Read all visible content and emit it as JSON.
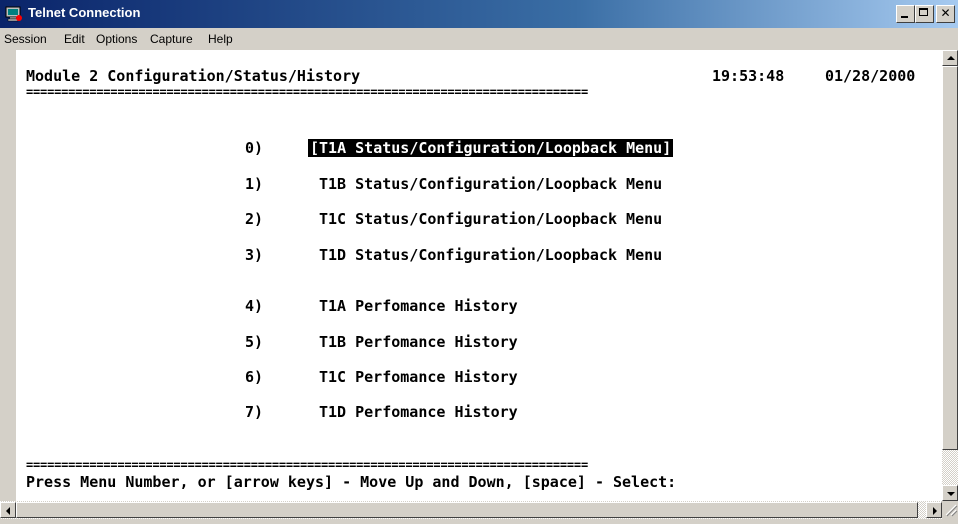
{
  "window": {
    "title": "Telnet Connection",
    "icon": "telnet-icon",
    "controls": [
      "minimize-icon",
      "maximize-icon",
      "close-icon"
    ]
  },
  "menubar": {
    "items": [
      "Session",
      "Edit",
      "Options",
      "Capture",
      "Help"
    ]
  },
  "terminal": {
    "header": "Module 2 Configuration/Status/History",
    "time": "19:53:48",
    "date": "01/28/2000",
    "separator": "================================================================================",
    "selected_index": 0,
    "menu": [
      {
        "num": "0)",
        "label": "[T1A Status/Configuration/Loopback Menu]"
      },
      {
        "num": "1)",
        "label": "T1B Status/Configuration/Loopback Menu"
      },
      {
        "num": "2)",
        "label": "T1C Status/Configuration/Loopback Menu"
      },
      {
        "num": "3)",
        "label": "T1D Status/Configuration/Loopback Menu"
      },
      {
        "num": "4)",
        "label": "T1A Perfomance History"
      },
      {
        "num": "5)",
        "label": "T1B Perfomance History"
      },
      {
        "num": "6)",
        "label": "T1C Perfomance History"
      },
      {
        "num": "7)",
        "label": "T1D Perfomance History"
      }
    ],
    "prompt": "Press Menu Number, or [arrow keys] - Move Up and Down, [space] - Select:"
  },
  "colors": {
    "title_bar_start": "#0a246a",
    "title_bar_end": "#a6caf0",
    "terminal_bg": "#ffffff",
    "terminal_text": "#000000",
    "selection_bg": "#000000",
    "selection_text": "#ffffff"
  }
}
